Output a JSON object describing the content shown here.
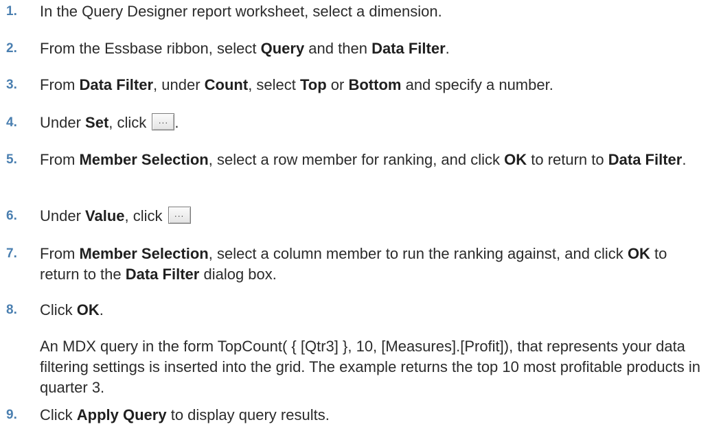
{
  "steps": [
    {
      "num": "1.",
      "parts": [
        "In the Query Designer report worksheet, select a dimension."
      ]
    },
    {
      "num": "2.",
      "parts": [
        "From the Essbase ribbon, select ",
        "Query",
        " and then ",
        "Data Filter",
        "."
      ]
    },
    {
      "num": "3.",
      "parts": [
        "From ",
        "Data Filter",
        ", under ",
        "Count",
        ", select ",
        "Top",
        " or ",
        "Bottom",
        " and specify a number."
      ]
    },
    {
      "num": "4.",
      "parts": [
        "Under ",
        "Set",
        ", click",
        "."
      ]
    },
    {
      "num": "5.",
      "parts": [
        "From ",
        "Member Selection",
        ", select a row member for ranking, and click ",
        "OK",
        " to return to ",
        "Data Filter",
        "."
      ]
    },
    {
      "num": "6.",
      "parts": [
        "Under ",
        "Value",
        ", click"
      ]
    },
    {
      "num": "7.",
      "parts": [
        "From ",
        "Member Selection",
        ", select a column member to run the ranking against, and click ",
        "OK",
        " to return to the ",
        "Data Filter",
        " dialog box."
      ]
    },
    {
      "num": "8.",
      "parts": [
        "Click ",
        "OK",
        "."
      ]
    },
    {
      "num": "9.",
      "parts": [
        "Click ",
        "Apply Query",
        " to display query results."
      ]
    }
  ],
  "note": "An MDX query in the form TopCount( { [Qtr3] }, 10, [Measures].[Profit]), that represents your data filtering settings is inserted into the grid. The example returns the top 10 most profitable products in quarter 3.",
  "ellipsis_button": {
    "glyph": "..."
  }
}
